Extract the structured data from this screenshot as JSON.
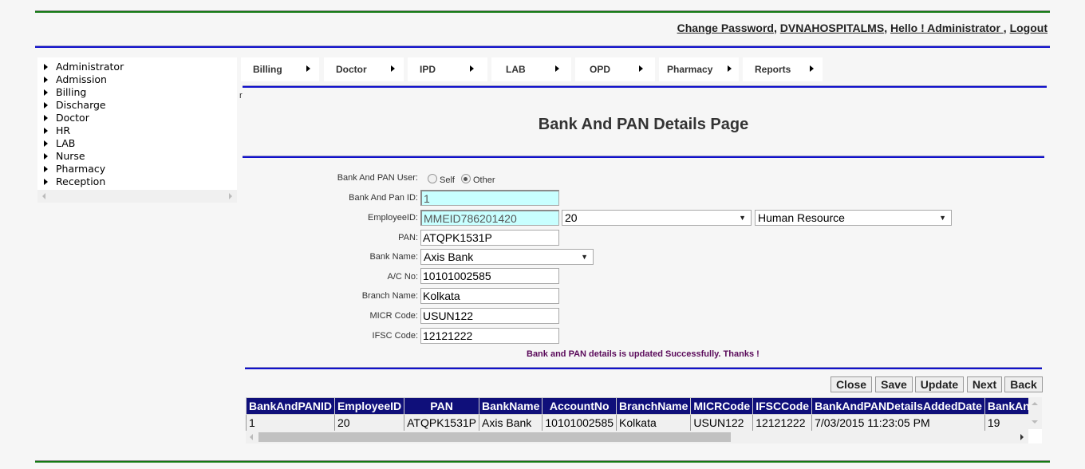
{
  "header": {
    "links": [
      "Change Password",
      "DVNAHOSPITALMS",
      "Hello ! Administrator ",
      "Logout"
    ],
    "separator": ", "
  },
  "sidebar": {
    "items": [
      "Administrator",
      "Admission",
      "Billing",
      "Discharge",
      "Doctor",
      "HR",
      "LAB",
      "Nurse",
      "Pharmacy",
      "Reception"
    ]
  },
  "menubar": {
    "items": [
      "Billing",
      "Doctor",
      "IPD",
      "LAB",
      "OPD",
      "Pharmacy",
      "Reports"
    ]
  },
  "stray_text": "r",
  "page_title": "Bank And PAN Details Page",
  "form": {
    "user_label": "Bank And PAN User:",
    "user_options": [
      {
        "label": "Self",
        "checked": false
      },
      {
        "label": "Other",
        "checked": true
      }
    ],
    "id_label": "Bank And Pan ID:",
    "id_value": "1",
    "employee_label": "EmployeeID:",
    "employee_value": "MMEID786201420",
    "employee_select": "20",
    "department_select": "Human Resource",
    "pan_label": "PAN:",
    "pan_value": "ATQPK1531P",
    "bank_label": "Bank Name:",
    "bank_value": "Axis Bank",
    "acno_label": "A/C No:",
    "acno_value": "10101002585",
    "branch_label": "Branch Name:",
    "branch_value": "Kolkata",
    "micr_label": "MICR Code:",
    "micr_value": "USUN122",
    "ifsc_label": "IFSC Code:",
    "ifsc_value": "12121222"
  },
  "message": "Bank and PAN details is updated Successfully. Thanks !",
  "buttons": {
    "close": "Close",
    "save": "Save",
    "update": "Update",
    "next": "Next",
    "back": "Back"
  },
  "grid": {
    "columns": [
      "BankAndPANID",
      "EmployeeID",
      "PAN",
      "BankName",
      "AccountNo",
      "BranchName",
      "MICRCode",
      "IFSCCode",
      "BankAndPANDetailsAddedDate",
      "BankAndPANDetailsAddedBy"
    ],
    "rows": [
      [
        "1",
        "20",
        "ATQPK1531P",
        "Axis Bank",
        "10101002585",
        "Kolkata",
        "USUN122",
        "12121222",
        "7/03/2015 11:23:05 PM",
        "19"
      ]
    ]
  }
}
